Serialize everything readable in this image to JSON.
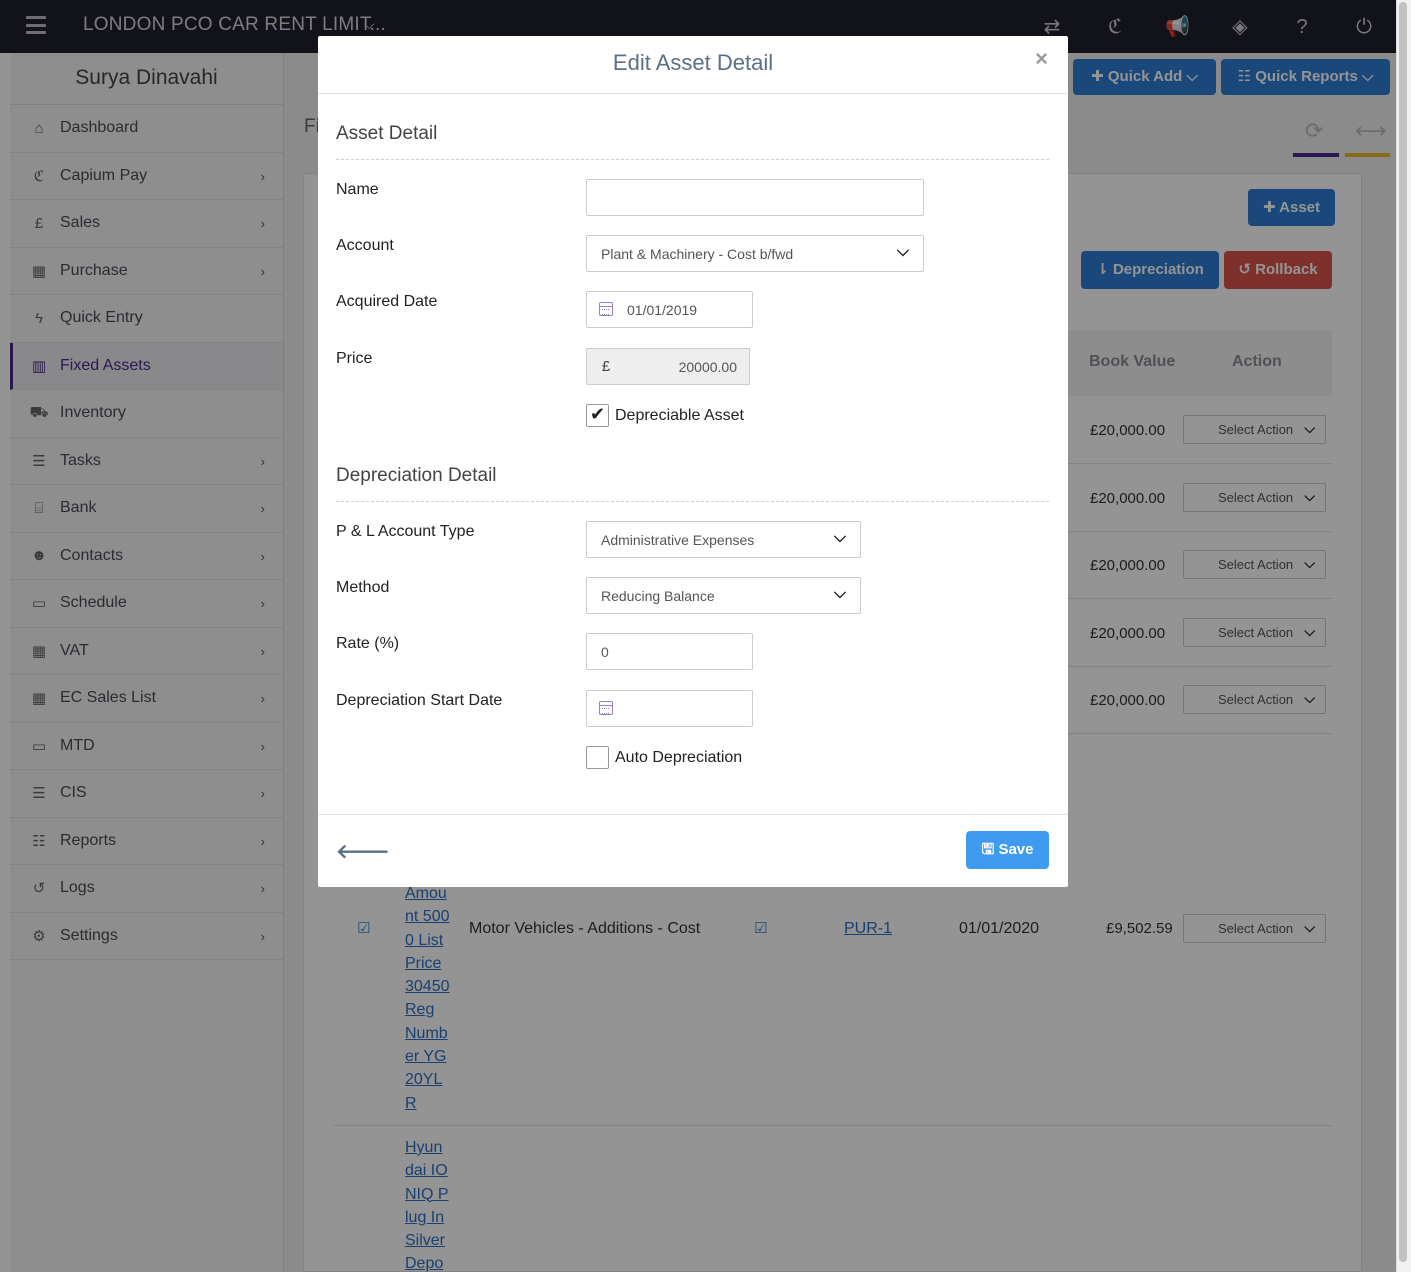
{
  "topbar": {
    "company": "LONDON PCO CAR RENT LIMIT...",
    "icons": [
      "transfer-icon",
      "capium-icon",
      "megaphone-icon",
      "tag-icon",
      "help-icon",
      "power-icon"
    ]
  },
  "sidebar": {
    "user_name": "Surya Dinavahi",
    "items": [
      {
        "label": "Dashboard",
        "icon": "⌂",
        "chevron": false
      },
      {
        "label": "Capium Pay",
        "icon": "ℭ",
        "chevron": true
      },
      {
        "label": "Sales",
        "icon": "£",
        "chevron": true
      },
      {
        "label": "Purchase",
        "icon": "▦",
        "chevron": true
      },
      {
        "label": "Quick Entry",
        "icon": "ϟ",
        "chevron": false
      },
      {
        "label": "Fixed Assets",
        "icon": "▥",
        "chevron": false
      },
      {
        "label": "Inventory",
        "icon": "⛟",
        "chevron": false
      },
      {
        "label": "Tasks",
        "icon": "☰",
        "chevron": true
      },
      {
        "label": "Bank",
        "icon": "⌸",
        "chevron": true
      },
      {
        "label": "Contacts",
        "icon": "☻",
        "chevron": true
      },
      {
        "label": "Schedule",
        "icon": "▭",
        "chevron": true
      },
      {
        "label": "VAT",
        "icon": "▦",
        "chevron": true
      },
      {
        "label": "EC Sales List",
        "icon": "▦",
        "chevron": true
      },
      {
        "label": "MTD",
        "icon": "▭",
        "chevron": true
      },
      {
        "label": "CIS",
        "icon": "☰",
        "chevron": true
      },
      {
        "label": "Reports",
        "icon": "☷",
        "chevron": true
      },
      {
        "label": "Logs",
        "icon": "↺",
        "chevron": true
      },
      {
        "label": "Settings",
        "icon": "⚙",
        "chevron": true
      }
    ]
  },
  "header_buttons": {
    "quick_add": "Quick Add",
    "quick_reports": "Quick Reports"
  },
  "page": {
    "title_fragment": "Fi",
    "add_asset": "Asset",
    "depreciation": "Depreciation",
    "rollback": "Rollback",
    "col_book_value": "Book Value",
    "col_action": "Action",
    "select_action": "Select Action",
    "book_values": [
      "£20,000.00",
      "£20,000.00",
      "£20,000.00",
      "£20,000.00",
      "£20,000.00"
    ],
    "row_detail": {
      "link_text": "Amount 5000 List Price 30450 Reg Number YG20YLR",
      "account": "Motor Vehicles - Additions - Cost",
      "ref": "PUR-1",
      "date": "01/01/2020",
      "value": "£9,502.59"
    },
    "next_link_text": "Hyundai IONIQ Plug In Silver Depo"
  },
  "modal": {
    "title": "Edit Asset Detail",
    "close": "×",
    "asset_section": "Asset Detail",
    "name_label": "Name",
    "name_value": "",
    "account_label": "Account",
    "account_value": "Plant & Machinery - Cost b/fwd",
    "acquired_label": "Acquired Date",
    "acquired_value": "01/01/2019",
    "price_label": "Price",
    "currency": "£",
    "price_value": "20000.00",
    "depreciable_label": "Depreciable Asset",
    "depreciable_checked": true,
    "dep_section": "Depreciation Detail",
    "pl_label": "P & L Account Type",
    "pl_value": "Administrative Expenses",
    "method_label": "Method",
    "method_value": "Reducing Balance",
    "rate_label": "Rate (%)",
    "rate_value": "0",
    "start_label": "Depreciation Start Date",
    "start_value": "",
    "auto_label": "Auto Depreciation",
    "auto_checked": false,
    "save": "Save"
  },
  "colors": {
    "topbar": "#1f1f2e",
    "accent_purple": "#4b2a8a",
    "primary_blue": "#2d7dd2",
    "danger_red": "#d9534f",
    "save_blue": "#3f9bf0",
    "modal_title": "#5b6f85"
  }
}
